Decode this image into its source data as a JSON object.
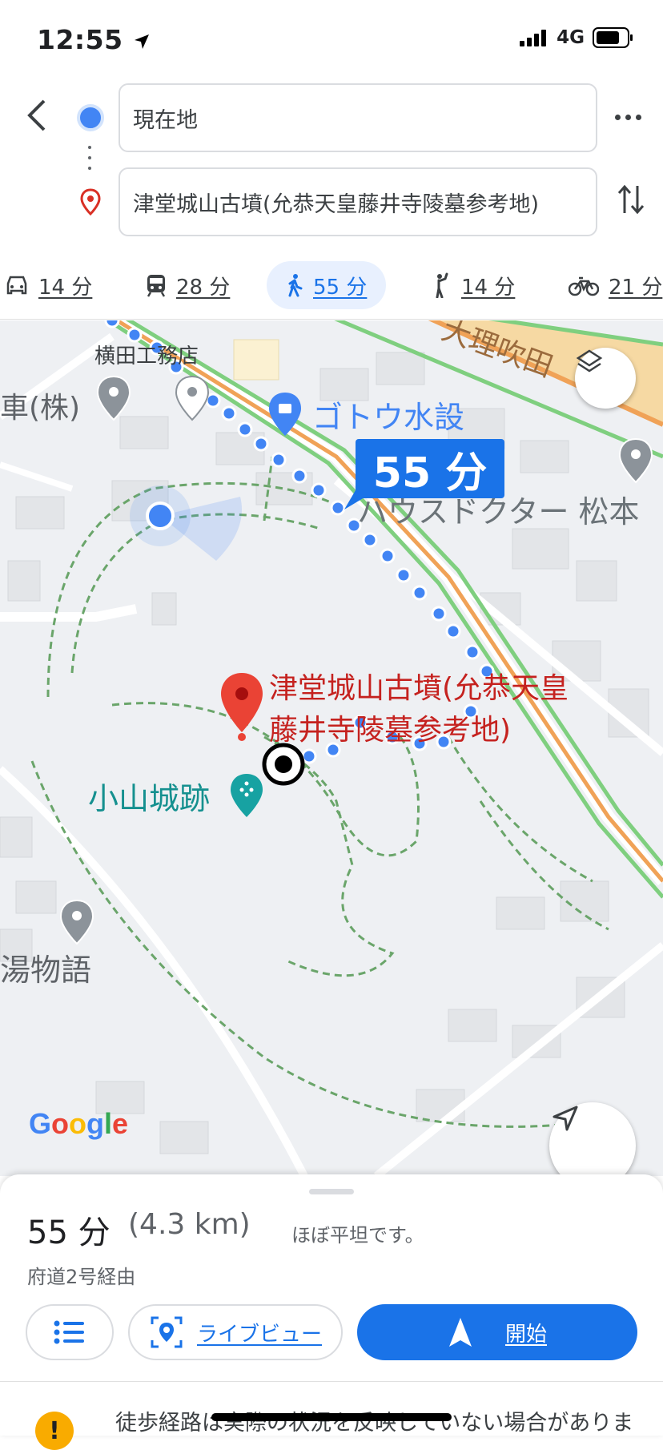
{
  "status_bar": {
    "time": "12:55",
    "network": "4G"
  },
  "directions": {
    "origin": "現在地",
    "destination": "津堂城山古墳(允恭天皇藤井寺陵墓参考地)"
  },
  "modes": [
    {
      "name": "car",
      "label": "14 分"
    },
    {
      "name": "transit",
      "label": "28 分"
    },
    {
      "name": "walk",
      "label": "55 分",
      "selected": true
    },
    {
      "name": "ride",
      "label": "14 分"
    },
    {
      "name": "bike",
      "label": "21 分"
    }
  ],
  "map": {
    "route_time_bubble": "55 分",
    "destination_label_line1": "津堂城山古墳(允恭天皇",
    "destination_label_line2": "藤井寺陵墓参考地)",
    "places": {
      "yokota": "横田工務店",
      "shop_left": "車(株)",
      "goto": "ゴトウ水設",
      "house_doctor": "ハウスドクター 松本",
      "road": "大理吹田",
      "castle": "小山城跡",
      "yu": "湯物語"
    },
    "logo": "Google"
  },
  "summary": {
    "time": "55 分",
    "distance": "(4.3 km)",
    "terrain": "ほぼ平坦です。",
    "via": "府道2号経由"
  },
  "buttons": {
    "live_view": "ライブビュー",
    "start": "開始"
  },
  "warning": {
    "text": "徒歩経路は実際の状況を反映していない場合がありま"
  },
  "colors": {
    "accent": "#1a73e8",
    "route": "#4285f4",
    "pin": "#ea4335",
    "park_path": "#6aa56a"
  }
}
